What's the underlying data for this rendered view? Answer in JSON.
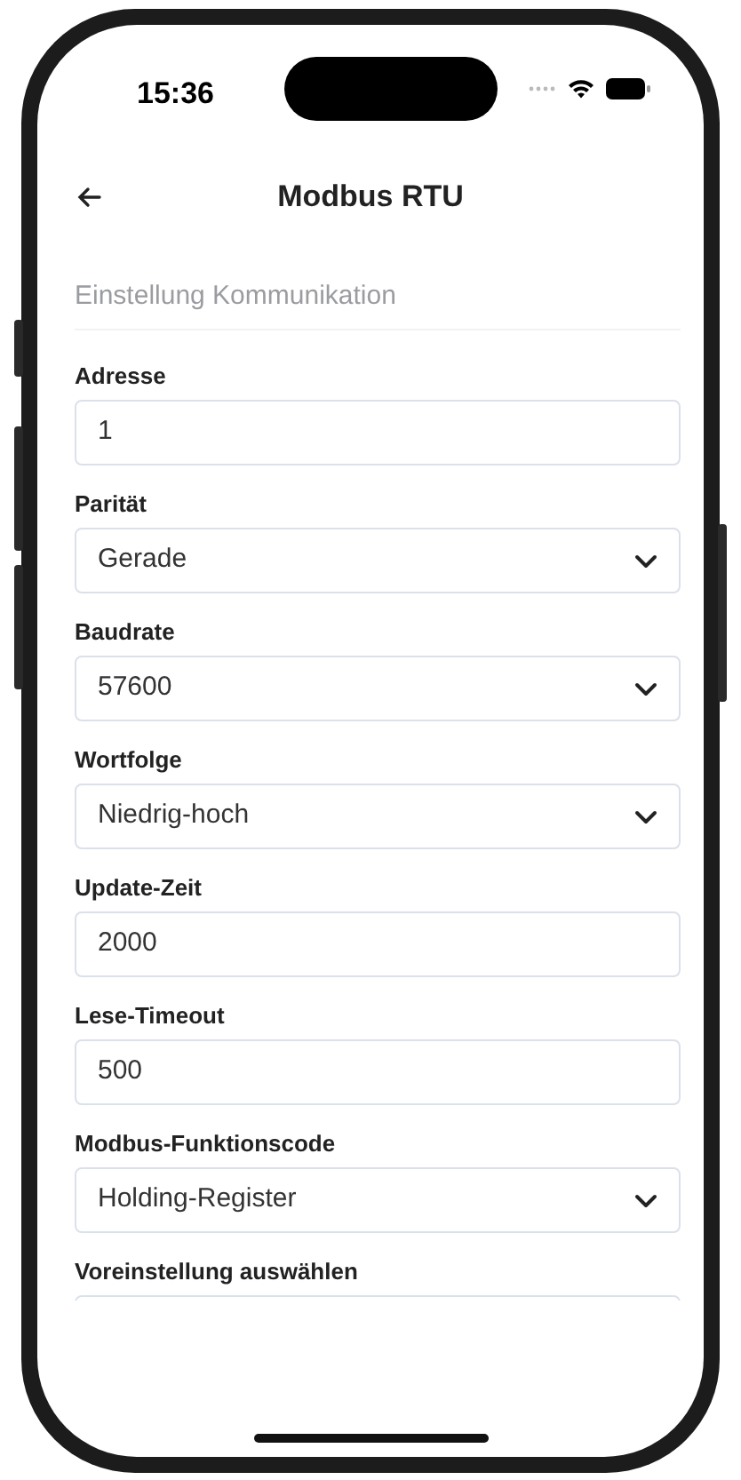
{
  "status_bar": {
    "time": "15:36"
  },
  "header": {
    "title": "Modbus RTU"
  },
  "section": {
    "title": "Einstellung Kommunikation"
  },
  "fields": [
    {
      "kind": "input",
      "label": "Adresse",
      "value": "1"
    },
    {
      "kind": "select",
      "label": "Parität",
      "value": "Gerade"
    },
    {
      "kind": "select",
      "label": "Baudrate",
      "value": "57600"
    },
    {
      "kind": "select",
      "label": "Wortfolge",
      "value": "Niedrig-hoch"
    },
    {
      "kind": "input",
      "label": "Update-Zeit",
      "value": "2000"
    },
    {
      "kind": "input",
      "label": "Lese-Timeout",
      "value": "500"
    },
    {
      "kind": "select",
      "label": "Modbus-Funktionscode",
      "value": "Holding-Register"
    },
    {
      "kind": "select",
      "label": "Voreinstellung auswählen"
    }
  ]
}
